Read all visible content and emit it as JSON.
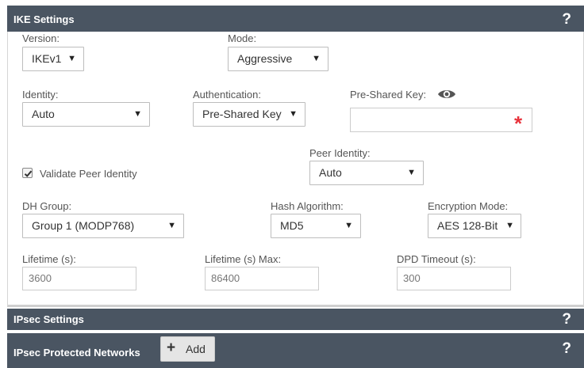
{
  "ike": {
    "title": "IKE Settings",
    "help": "?",
    "version": {
      "label": "Version:",
      "value": "IKEv1"
    },
    "mode": {
      "label": "Mode:",
      "value": "Aggressive"
    },
    "identity": {
      "label": "Identity:",
      "value": "Auto"
    },
    "authentication": {
      "label": "Authentication:",
      "value": "Pre-Shared Key"
    },
    "psk": {
      "label": "Pre-Shared Key:",
      "value": "",
      "required_mark": "*"
    },
    "validate_peer": {
      "label": "Validate Peer Identity",
      "checked": true
    },
    "peer_identity": {
      "label": "Peer Identity:",
      "value": "Auto"
    },
    "dh_group": {
      "label": "DH Group:",
      "value": "Group 1 (MODP768)"
    },
    "hash": {
      "label": "Hash Algorithm:",
      "value": "MD5"
    },
    "encryption": {
      "label": "Encryption Mode:",
      "value": "AES 128-Bit"
    },
    "lifetime": {
      "label": "Lifetime (s):",
      "value": "3600"
    },
    "lifetime_max": {
      "label": "Lifetime (s) Max:",
      "value": "86400"
    },
    "dpd_timeout": {
      "label": "DPD Timeout (s):",
      "value": "300"
    }
  },
  "ipsec": {
    "title": "IPsec Settings",
    "help": "?"
  },
  "networks": {
    "title": "IPsec Protected Networks",
    "add_label": "Add",
    "add_icon": "plus-icon",
    "help": "?"
  },
  "icons": {
    "dropdown": "triangle-down-icon",
    "eye": "eye-icon",
    "check": "checkmark-icon"
  },
  "colors": {
    "header_bar": "#4a5562",
    "required": "#e8333c",
    "add_button": "#e5e5e5"
  }
}
